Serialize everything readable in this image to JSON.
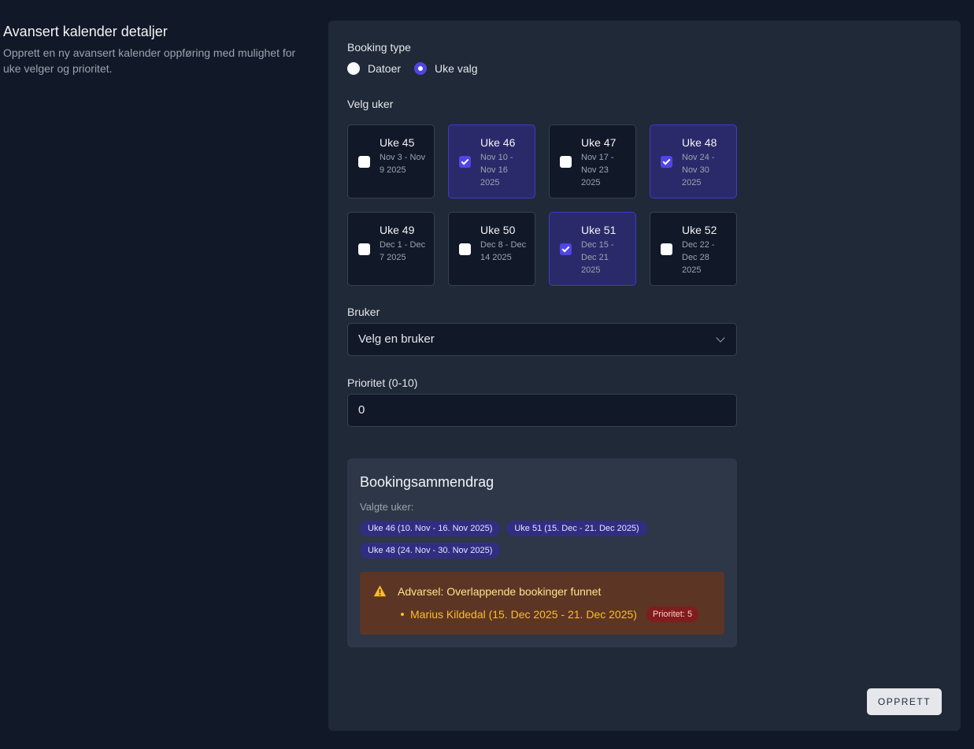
{
  "aside": {
    "title": "Avansert kalender detaljer",
    "description": "Opprett en ny avansert kalender oppføring med mulighet for uke velger og prioritet."
  },
  "booking_type": {
    "label": "Booking type",
    "options": [
      {
        "label": "Datoer",
        "selected": false
      },
      {
        "label": "Uke valg",
        "selected": true
      }
    ]
  },
  "weeks": {
    "label": "Velg uker",
    "items": [
      {
        "title": "Uke 45",
        "range": "Nov 3 - Nov 9 2025",
        "checked": false
      },
      {
        "title": "Uke 46",
        "range": "Nov 10 - Nov 16 2025",
        "checked": true
      },
      {
        "title": "Uke 47",
        "range": "Nov 17 - Nov 23 2025",
        "checked": false
      },
      {
        "title": "Uke 48",
        "range": "Nov 24 - Nov 30 2025",
        "checked": true
      },
      {
        "title": "Uke 49",
        "range": "Dec 1 - Dec 7 2025",
        "checked": false
      },
      {
        "title": "Uke 50",
        "range": "Dec 8 - Dec 14 2025",
        "checked": false
      },
      {
        "title": "Uke 51",
        "range": "Dec 15 - Dec 21 2025",
        "checked": true
      },
      {
        "title": "Uke 52",
        "range": "Dec 22 - Dec 28 2025",
        "checked": false
      }
    ]
  },
  "user": {
    "label": "Bruker",
    "value": "Velg en bruker"
  },
  "priority": {
    "label": "Prioritet (0-10)",
    "value": "0"
  },
  "summary": {
    "title": "Bookingsammendrag",
    "selected_label": "Valgte uker:",
    "chips": [
      "Uke 46 (10. Nov - 16. Nov 2025)",
      "Uke 51 (15. Dec - 21. Dec 2025)",
      "Uke 48 (24. Nov - 30. Nov 2025)"
    ],
    "warning": {
      "title": "Advarsel: Overlappende bookinger funnet",
      "items": [
        {
          "text": "Marius Kildedal (15. Dec 2025 - 21. Dec 2025)",
          "badge": "Prioritet: 5"
        }
      ]
    }
  },
  "actions": {
    "submit_label": "OPPRETT"
  },
  "colors": {
    "background": "#111827",
    "card": "#1f2937",
    "accent": "#4f46e5",
    "warning_bg": "#5c3524",
    "warning_text": "#fbbf24"
  }
}
